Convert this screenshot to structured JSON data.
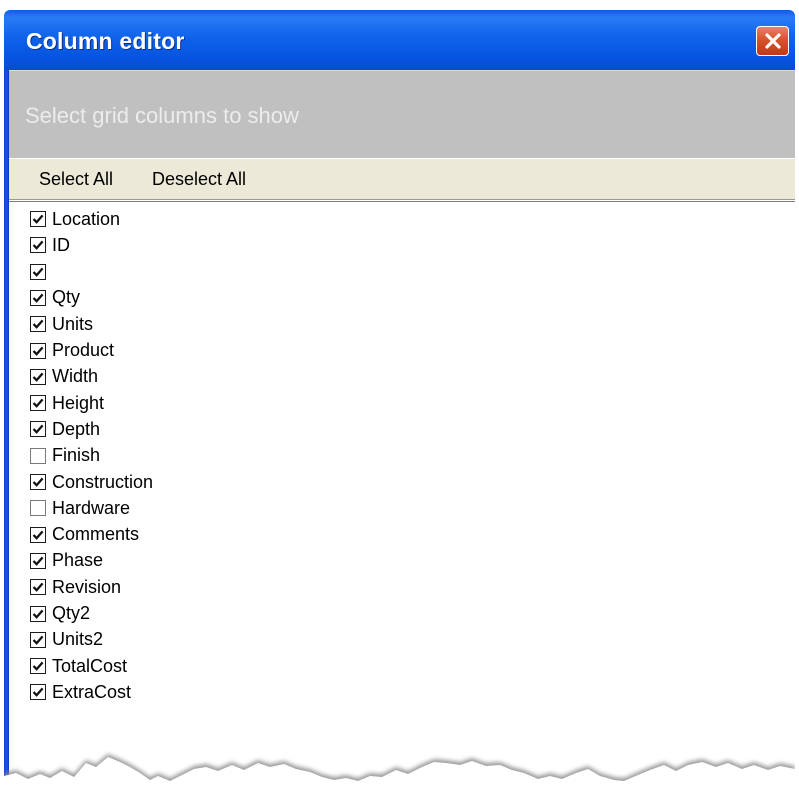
{
  "window": {
    "title": "Column editor",
    "close_icon": "close-icon"
  },
  "header": {
    "text": "Select grid columns to show"
  },
  "toolbar": {
    "select_all_label": "Select All",
    "deselect_all_label": "Deselect All"
  },
  "columns": {
    "items": [
      {
        "label": "Location",
        "checked": true
      },
      {
        "label": "ID",
        "checked": true
      },
      {
        "label": "",
        "checked": true
      },
      {
        "label": "Qty",
        "checked": true
      },
      {
        "label": "Units",
        "checked": true
      },
      {
        "label": "Product",
        "checked": true
      },
      {
        "label": "Width",
        "checked": true
      },
      {
        "label": "Height",
        "checked": true
      },
      {
        "label": "Depth",
        "checked": true
      },
      {
        "label": "Finish",
        "checked": false
      },
      {
        "label": "Construction",
        "checked": true
      },
      {
        "label": "Hardware",
        "checked": false
      },
      {
        "label": "Comments",
        "checked": true
      },
      {
        "label": "Phase",
        "checked": true
      },
      {
        "label": "Revision",
        "checked": true
      },
      {
        "label": "Qty2",
        "checked": true
      },
      {
        "label": "Units2",
        "checked": true
      },
      {
        "label": "TotalCost",
        "checked": true
      },
      {
        "label": "ExtraCost",
        "checked": true
      }
    ]
  },
  "colors": {
    "titlebar": "#0a5ddf",
    "header_band": "#c0c0c0",
    "toolbar": "#ece9d8",
    "close_button": "#d8522d"
  }
}
